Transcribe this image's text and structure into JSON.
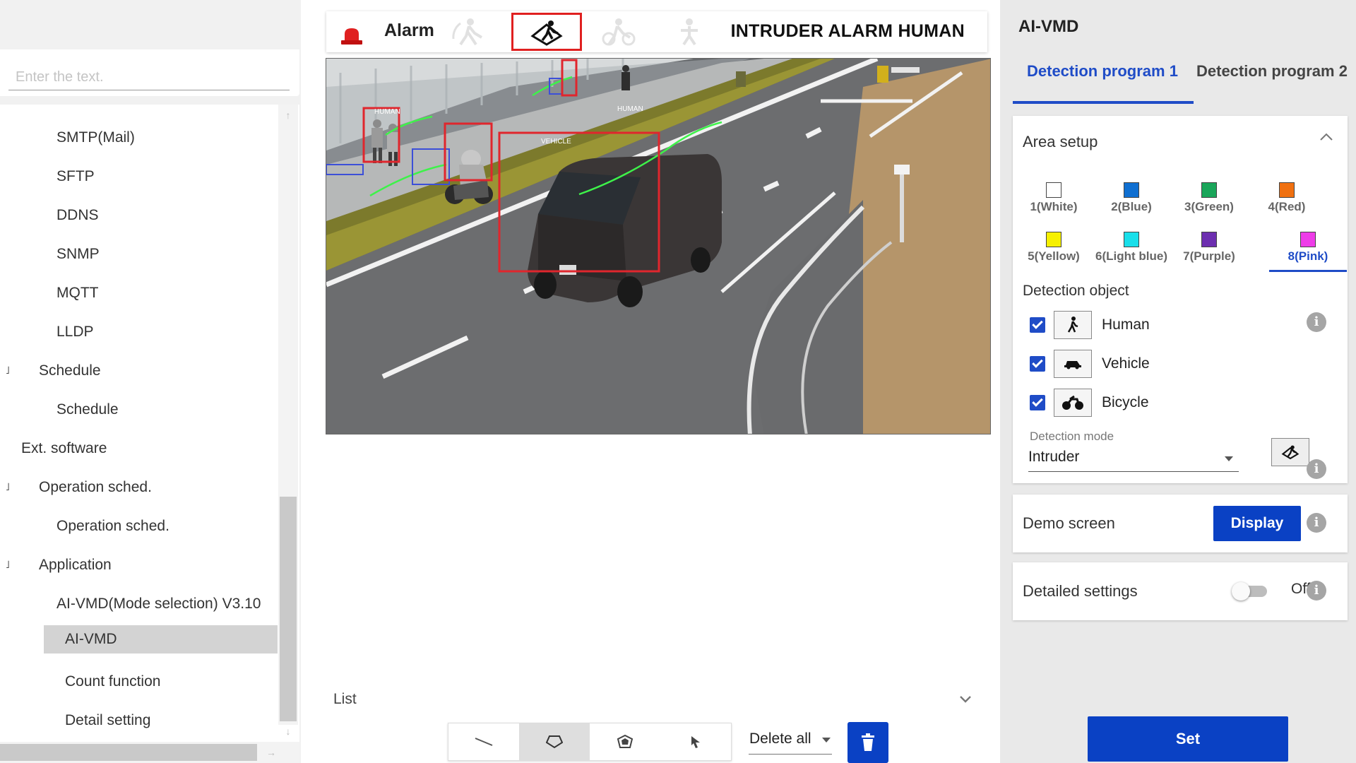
{
  "search": {
    "placeholder": "Enter the text."
  },
  "nav": {
    "items": [
      {
        "label": "SMTP(Mail)"
      },
      {
        "label": "SFTP"
      },
      {
        "label": "DDNS"
      },
      {
        "label": "SNMP"
      },
      {
        "label": "MQTT"
      },
      {
        "label": "LLDP"
      },
      {
        "label": "Schedule"
      },
      {
        "label": "Schedule"
      },
      {
        "label": "Ext. software"
      },
      {
        "label": "Operation sched."
      },
      {
        "label": "Operation sched."
      },
      {
        "label": "Application"
      },
      {
        "label": "AI-VMD(Mode selection) V3.10"
      },
      {
        "label": "AI-VMD"
      },
      {
        "label": "Count function"
      },
      {
        "label": "Detail setting"
      }
    ],
    "collapse_mark": "˩",
    "scroll_up": "↑",
    "scroll_down": "↓",
    "scroll_right": "→"
  },
  "alarm": {
    "label": "Alarm",
    "message": "INTRUDER ALARM HUMAN",
    "lamp_color": "#e02020",
    "active_icon": "intrusion-icon"
  },
  "camera": {
    "labels": {
      "human": "HUMAN",
      "vehicle": "VEHICLE"
    },
    "box_color": "#e0262d",
    "track_color": "#3ef24a",
    "neutral_box_color": "#3c4fd8"
  },
  "list": {
    "label": "List"
  },
  "toolbar": {
    "tools": [
      "line-tool-icon",
      "polygon-tool-icon",
      "area-polygon-tool-icon",
      "select-tool-icon"
    ],
    "delete_option": "Delete all"
  },
  "panel": {
    "title": "AI-VMD",
    "tabs": [
      {
        "label": "Detection program 1",
        "active": true
      },
      {
        "label": "Detection program 2",
        "active": false
      }
    ],
    "area_setup": {
      "title": "Area setup",
      "areas": [
        {
          "label": "1(White)",
          "color": "#ffffff"
        },
        {
          "label": "2(Blue)",
          "color": "#0f6fd1"
        },
        {
          "label": "3(Green)",
          "color": "#1aa65a"
        },
        {
          "label": "4(Red)",
          "color": "#f07010"
        },
        {
          "label": "5(Yellow)",
          "color": "#f6f000"
        },
        {
          "label": "6(Light blue)",
          "color": "#19dfea"
        },
        {
          "label": "7(Purple)",
          "color": "#6d2fb0"
        },
        {
          "label": "8(Pink)",
          "color": "#ee3ce8"
        }
      ],
      "selected_area": "8(Pink)",
      "detection_object_label": "Detection object",
      "objects": [
        {
          "label": "Human",
          "checked": true,
          "icon": "human-icon"
        },
        {
          "label": "Vehicle",
          "checked": true,
          "icon": "vehicle-icon"
        },
        {
          "label": "Bicycle",
          "checked": true,
          "icon": "bicycle-icon"
        }
      ],
      "detection_mode_label": "Detection mode",
      "detection_mode": "Intruder"
    },
    "demo": {
      "label": "Demo screen",
      "button": "Display"
    },
    "detailed": {
      "label": "Detailed settings",
      "state": "Off"
    },
    "info_glyph": "i",
    "set_button": "Set"
  }
}
